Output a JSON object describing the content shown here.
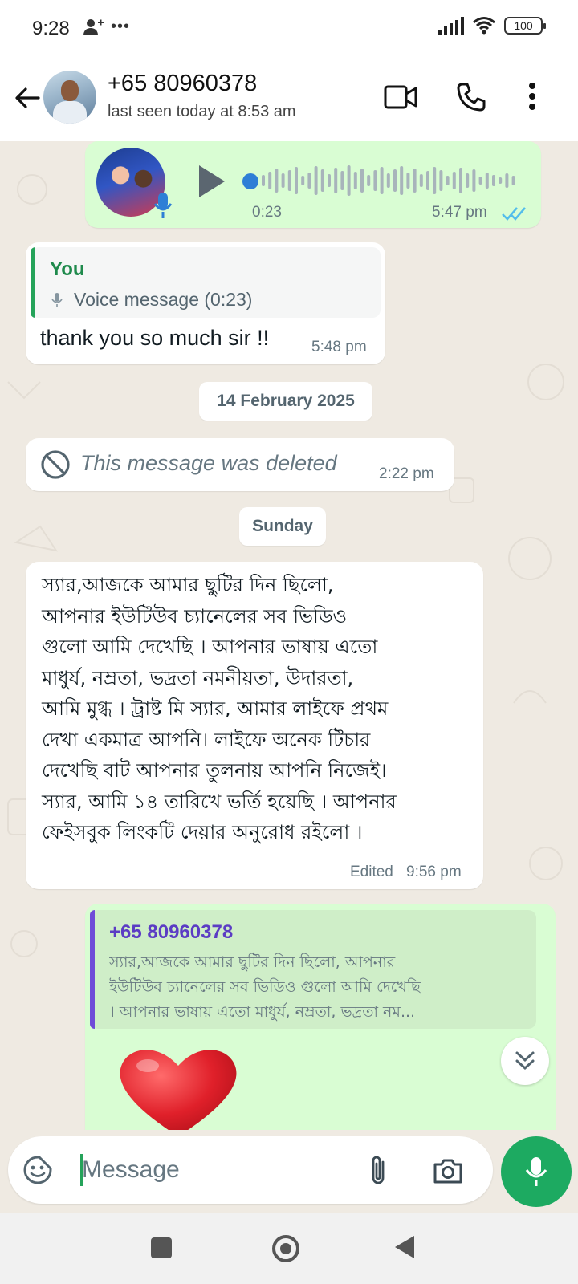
{
  "status_bar": {
    "time": "9:28",
    "left_icons": [
      "person-add-icon",
      "more-dots-icon"
    ],
    "battery": "100"
  },
  "header": {
    "contact_name": "+65 80960378",
    "last_seen": "last seen today at 8:53 am"
  },
  "messages": {
    "voice": {
      "duration": "0:23",
      "time": "5:47 pm",
      "status": "read"
    },
    "reply1": {
      "quote_author": "You",
      "quote_text": "Voice message (0:23)",
      "text": "thank you so much sir !!",
      "time": "5:48 pm"
    },
    "date_chip_1": "14 February 2025",
    "deleted": {
      "text": "This message was deleted",
      "time": "2:22 pm"
    },
    "date_chip_2": "Sunday",
    "long_incoming": {
      "lines": [
        "স্যার,আজকে আমার ছুটির দিন ছিলো,",
        "আপনার ইউটিউব চ্যানেলের সব ভিডিও",
        "গুলো আমি দেখেছি ।  আপনার ভাষায় এতো",
        "মাধুর্য, নম্রতা, ভদ্রতা নমনীয়তা, উদারতা,",
        "আমি মুগ্ধ । ট্রাষ্ট মি স্যার, আমার লাইফে প্রথম",
        "দেখা একমাত্র আপনি। লাইফে অনেক টিচার",
        "দেখেছি বাট আপনার তুলনায় আপনি নিজেই।",
        "স্যার, আমি ১৪ তারিখে ভর্তি হয়েছি । আপনার",
        "ফেইসবুক লিংকটি দেয়ার অনুরোধ রইলো ।"
      ],
      "edited_label": "Edited",
      "time": "9:56 pm"
    },
    "reply2": {
      "quote_author": "+65 80960378",
      "quote_lines": [
        "স্যার,আজকে আমার ছুটির দিন ছিলো, আপনার",
        "ইউটিউব চ্যানেলের সব ভিডিও গুলো আমি দেখেছি",
        "।  আপনার ভাষায় এতো মাধুর্য, নম্রতা, ভদ্রতা নম..."
      ],
      "content": "heart-emoji"
    }
  },
  "input": {
    "placeholder": "Message"
  },
  "colors": {
    "outgoing_bubble": "#d9fdd3",
    "incoming_bubble": "#ffffff",
    "accent_green": "#1daa61",
    "read_ticks": "#53bdeb",
    "quote_bar_you": "#25a35a",
    "quote_bar_contact": "#6f4bd8"
  }
}
